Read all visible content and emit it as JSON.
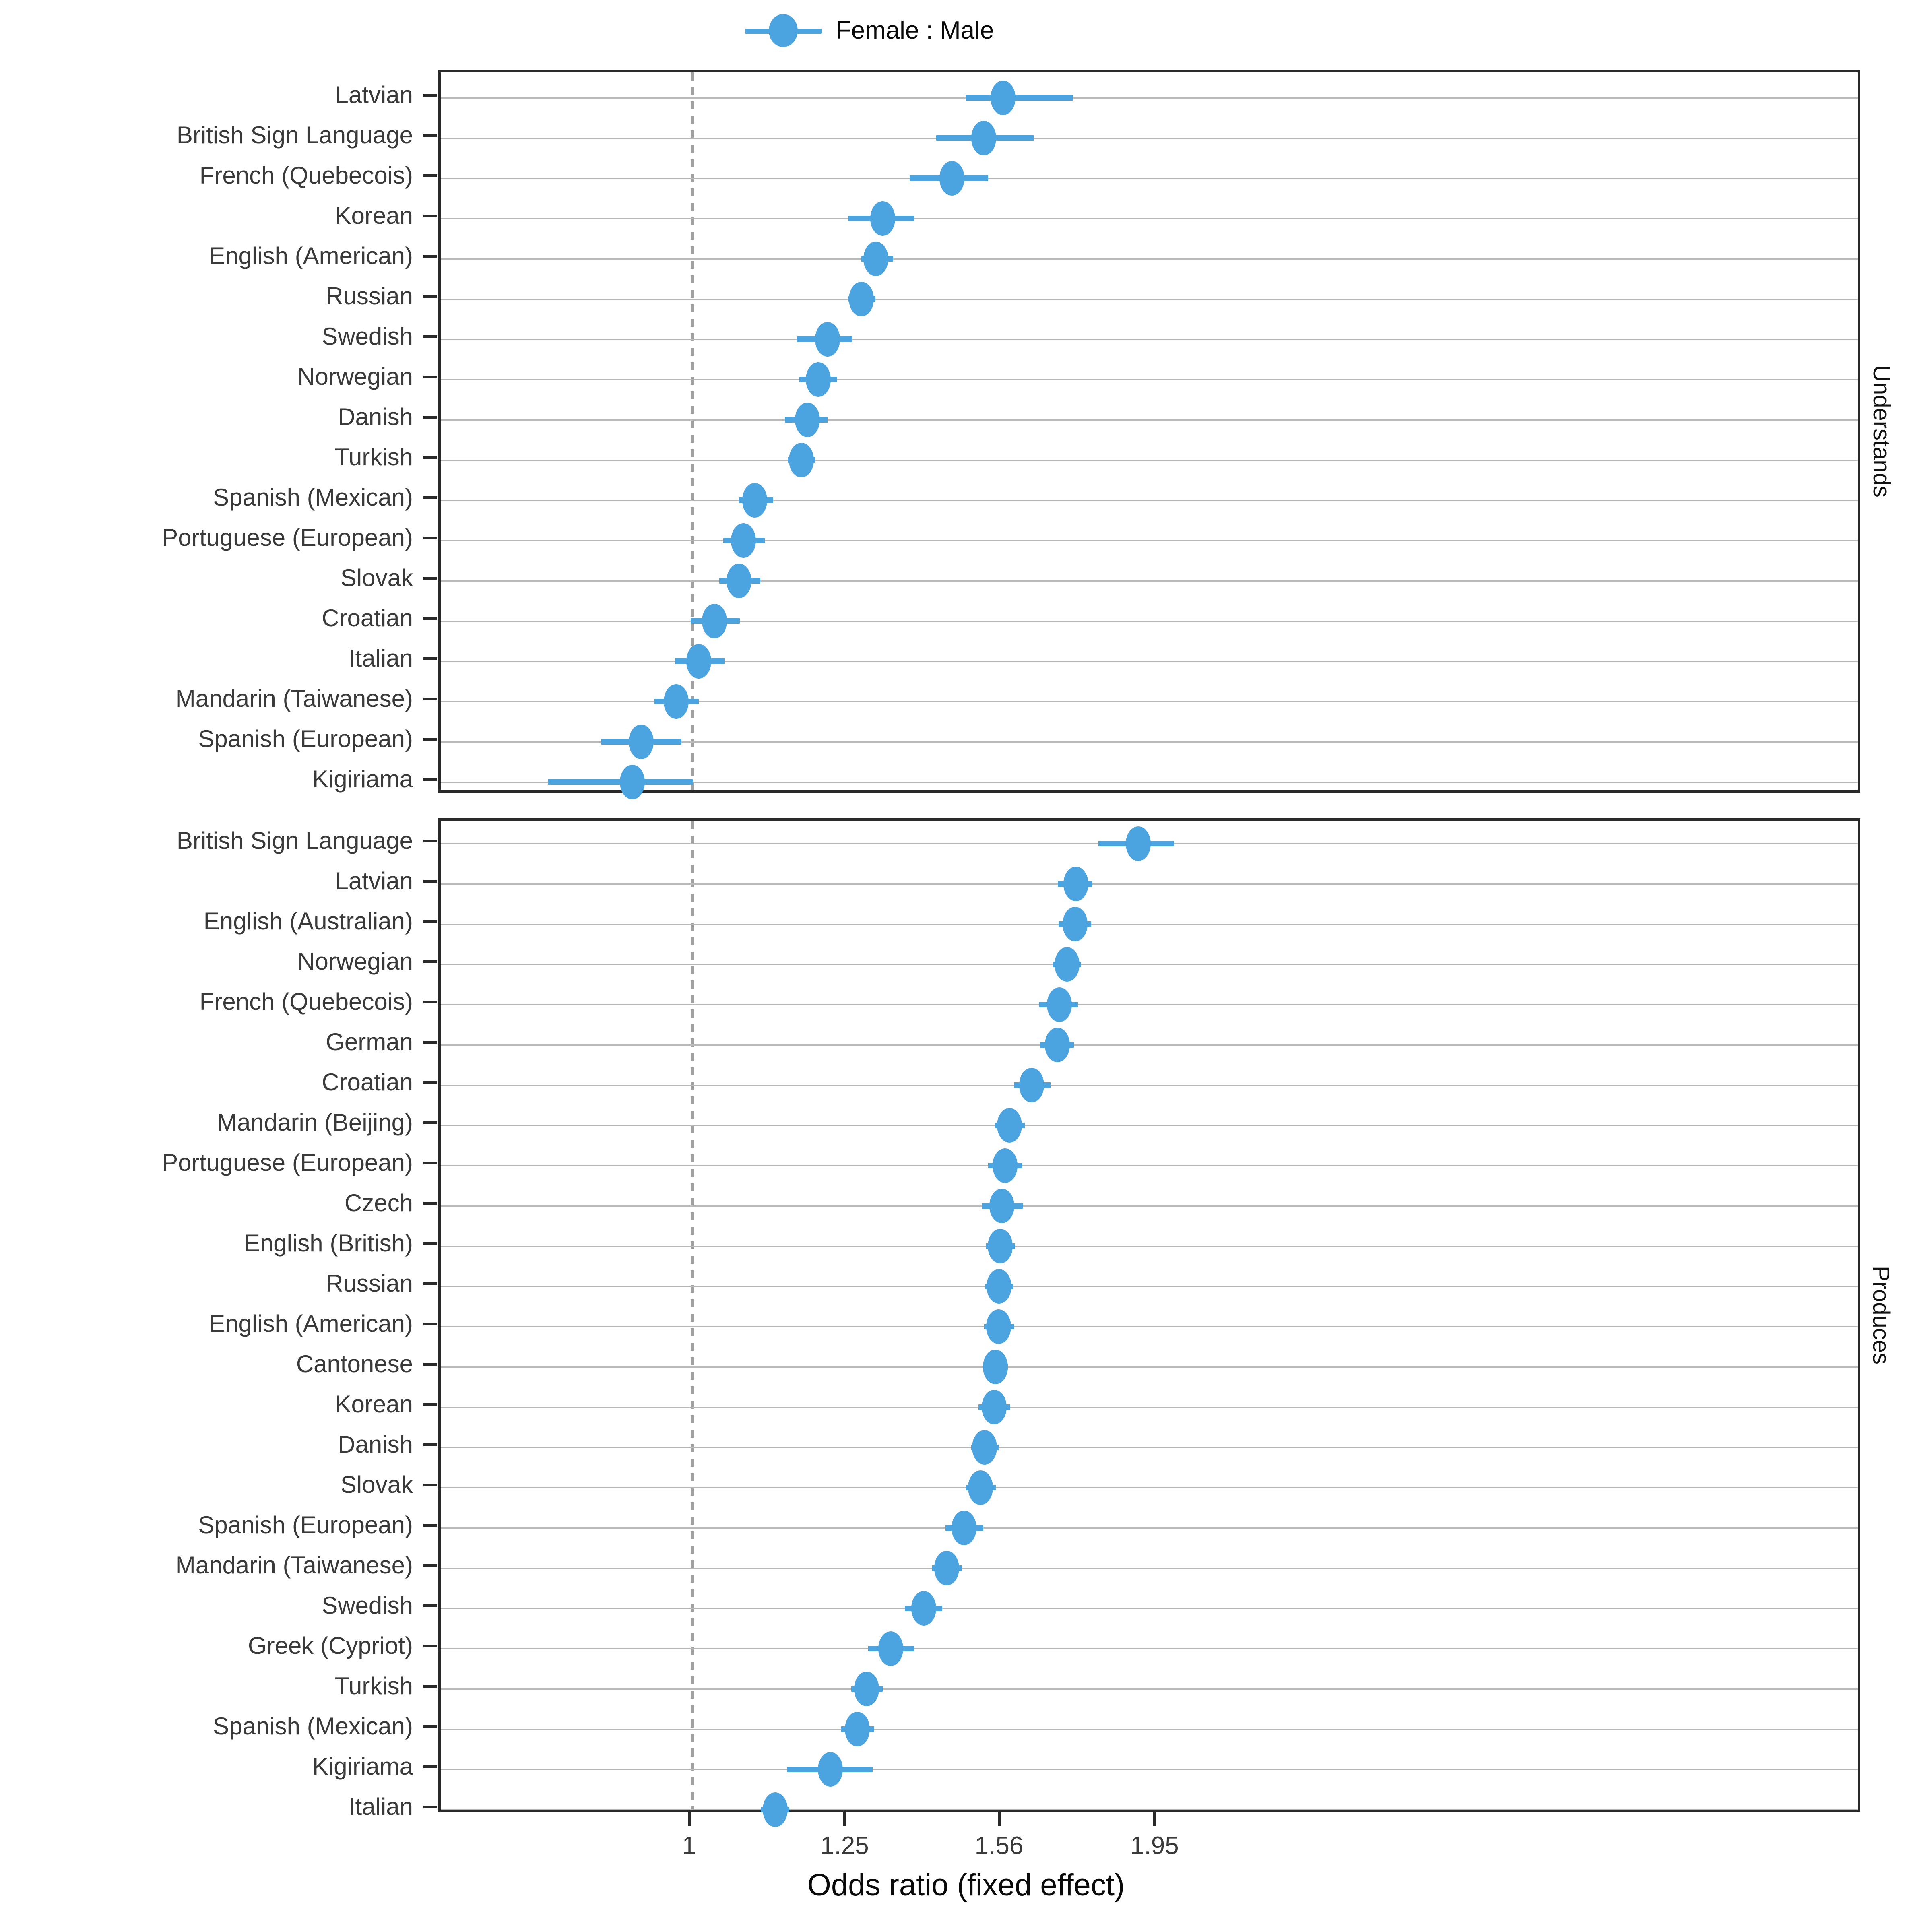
{
  "legend": {
    "label": "Female : Male",
    "marker_icon": "point-range-icon",
    "color": "#4BA3DF"
  },
  "axis": {
    "x_title": "Odds ratio (fixed effect)",
    "x_ticks": [
      "1",
      "1.25",
      "1.56",
      "1.95"
    ],
    "x_tick_values": [
      1,
      1.25,
      1.56,
      1.95
    ],
    "x_scale": "log10",
    "x_range": [
      0.698,
      2.09
    ],
    "reference_line": 1
  },
  "panels": [
    {
      "strip_label": "Understands"
    },
    {
      "strip_label": "Produces"
    }
  ],
  "chart_data": {
    "type": "scatter",
    "subtype": "forest-plot",
    "title": "",
    "xlabel": "Odds ratio (fixed effect)",
    "ylabel": "",
    "xscale": "log",
    "xlim": [
      0.698,
      2.09
    ],
    "xticks": [
      1,
      1.25,
      1.56,
      1.95
    ],
    "xticklabels": [
      "1",
      "1.25",
      "1.56",
      "1.95"
    ],
    "grid": "horizontal",
    "legend": [
      "Female : Male"
    ],
    "legend_position": "top",
    "reference_line": 1,
    "panels": [
      {
        "facet": "Understands",
        "categories": [
          "Latvian",
          "British Sign Language",
          "French (Quebecois)",
          "Korean",
          "English (American)",
          "Russian",
          "Swedish",
          "Norwegian",
          "Danish",
          "Turkish",
          "Spanish (Mexican)",
          "Portuguese (European)",
          "Slovak",
          "Croatian",
          "Italian",
          "Mandarin (Taiwanese)",
          "Spanish (European)",
          "Kigiriama"
        ],
        "values": [
          1.563,
          1.52,
          1.452,
          1.315,
          1.302,
          1.275,
          1.215,
          1.199,
          1.18,
          1.17,
          1.094,
          1.077,
          1.07,
          1.033,
          1.01,
          0.978,
          0.93,
          0.918
        ],
        "ci_low": [
          1.481,
          1.42,
          1.367,
          1.251,
          1.275,
          1.252,
          1.162,
          1.167,
          1.143,
          1.148,
          1.069,
          1.046,
          1.04,
          0.998,
          0.976,
          0.947,
          0.878,
          0.813
        ],
        "ci_high": [
          1.728,
          1.633,
          1.53,
          1.376,
          1.335,
          1.301,
          1.259,
          1.232,
          1.215,
          1.194,
          1.124,
          1.11,
          1.103,
          1.071,
          1.048,
          1.01,
          0.985,
          1.001
        ]
      },
      {
        "facet": "Produces",
        "categories": [
          "British Sign Language",
          "Latvian",
          "English (Australian)",
          "Norwegian",
          "French (Quebecois)",
          "German",
          "Croatian",
          "Mandarin (Beijing)",
          "Portuguese (European)",
          "Czech",
          "English (British)",
          "Russian",
          "English (American)",
          "Cantonese",
          "Korean",
          "Danish",
          "Slovak",
          "Spanish (European)",
          "Mandarin (Taiwanese)",
          "Swedish",
          "Greek (Cypriot)",
          "Turkish",
          "Spanish (Mexican)",
          "Kigiriama",
          "Italian"
        ],
        "values": [
          1.897,
          1.735,
          1.733,
          1.713,
          1.694,
          1.689,
          1.628,
          1.577,
          1.567,
          1.56,
          1.556,
          1.554,
          1.553,
          1.546,
          1.543,
          1.522,
          1.513,
          1.478,
          1.441,
          1.395,
          1.33,
          1.285,
          1.268,
          1.22,
          1.127
        ],
        "ci_low": [
          1.792,
          1.69,
          1.692,
          1.678,
          1.645,
          1.648,
          1.587,
          1.545,
          1.53,
          1.516,
          1.524,
          1.523,
          1.521,
          1.52,
          1.509,
          1.493,
          1.481,
          1.439,
          1.411,
          1.357,
          1.288,
          1.257,
          1.239,
          1.147,
          1.104
        ],
        "ci_high": [
          1.997,
          1.775,
          1.773,
          1.747,
          1.74,
          1.73,
          1.673,
          1.612,
          1.606,
          1.608,
          1.59,
          1.586,
          1.587,
          1.574,
          1.579,
          1.553,
          1.547,
          1.519,
          1.473,
          1.432,
          1.376,
          1.315,
          1.299,
          1.296,
          1.15
        ]
      }
    ]
  }
}
